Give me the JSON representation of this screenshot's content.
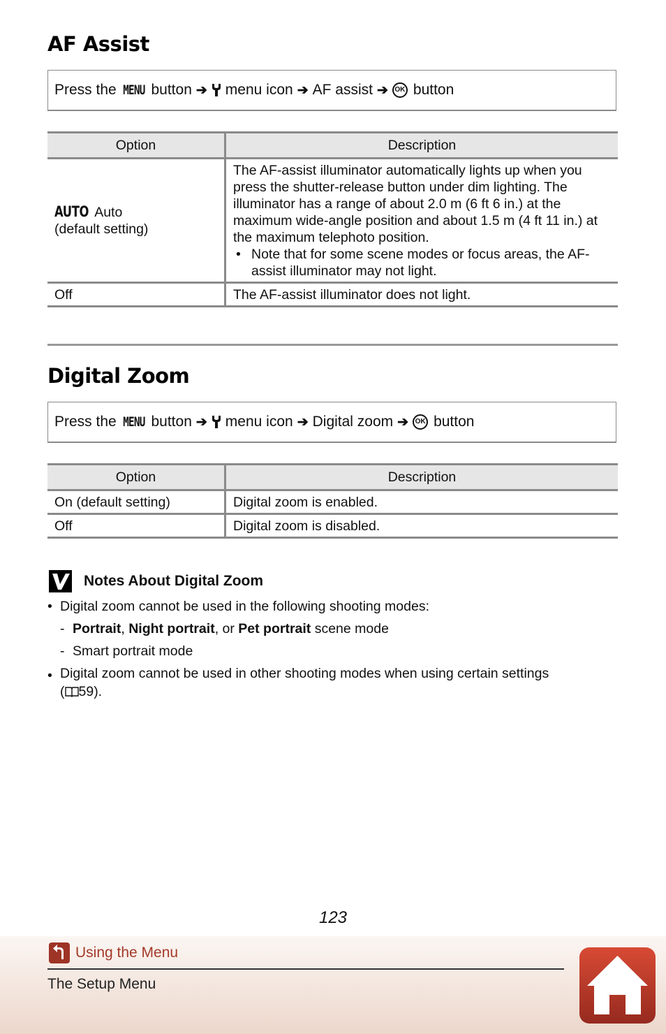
{
  "af_assist": {
    "title": "AF Assist",
    "path": {
      "press_the": "Press the",
      "menu_glyph": "MENU",
      "button1": "button",
      "arrow": "➔",
      "wrench_icon": "wrench-icon",
      "menu_icon": "menu icon",
      "item": "AF assist",
      "ok_glyph": "OK",
      "button2": "button"
    },
    "table": {
      "headers": [
        "Option",
        "Description"
      ],
      "rows": [
        {
          "option_glyph": "AUTO",
          "option": "Auto",
          "option_sub": "(default setting)",
          "description": "The AF-assist illuminator automatically lights up when you press the shutter-release button under dim lighting. The illuminator has a range of about 2.0 m (6 ft 6 in.) at the maximum wide-angle position and about 1.5 m (4 ft 11 in.) at the maximum telephoto position.",
          "bullet": "Note that for some scene modes or focus areas, the AF-assist illuminator may not light."
        },
        {
          "option": "Off",
          "description": "The AF-assist illuminator does not light."
        }
      ]
    }
  },
  "digital_zoom": {
    "title": "Digital Zoom",
    "path": {
      "press_the": "Press the",
      "menu_glyph": "MENU",
      "button1": "button",
      "arrow": "➔",
      "menu_icon": "menu icon",
      "item": "Digital zoom",
      "ok_glyph": "OK",
      "button2": "button"
    },
    "table": {
      "headers": [
        "Option",
        "Description"
      ],
      "rows": [
        {
          "option": "On (default setting)",
          "description": "Digital zoom is enabled."
        },
        {
          "option": "Off",
          "description": "Digital zoom is disabled."
        }
      ]
    }
  },
  "notes": {
    "title": "Notes About Digital Zoom",
    "bullet_char": "•",
    "dash_char": "-",
    "item1": "Digital zoom cannot be used in the following shooting modes:",
    "sub1": {
      "b1": "Portrait",
      "sep1": ", ",
      "b2": "Night portrait",
      "sep2": ", or ",
      "b3": "Pet portrait",
      "tail": " scene mode"
    },
    "sub2": "Smart portrait mode",
    "item2": "Digital zoom cannot be used in other shooting modes when using certain settings",
    "item2_ref_open": "(",
    "item2_ref_page": "59).",
    "item2_ref_icon": "book-icon"
  },
  "footer": {
    "page_number": "123",
    "breadcrumb": "Using the Menu",
    "sub_section": "The Setup Menu",
    "home_icon": "home-icon",
    "back_icon": "back-icon",
    "accent_color": "#a43a2a"
  }
}
